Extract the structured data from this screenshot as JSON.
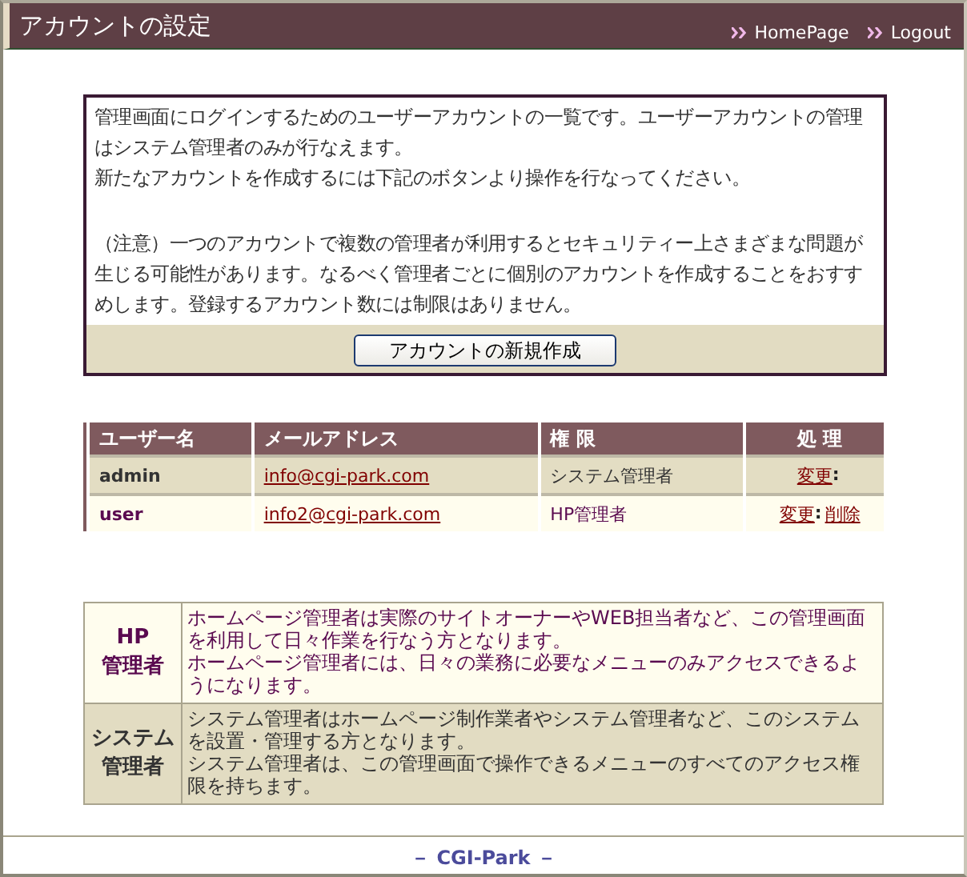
{
  "header": {
    "title": "アカウントの設定",
    "links": [
      {
        "label": "HomePage"
      },
      {
        "label": "Logout"
      }
    ]
  },
  "intro": {
    "paragraphs": [
      [
        "管理画面にログインするためのユーザーアカウントの一覧です。ユーザーアカウントの管理はシステム管理者のみが行なえます。",
        "新たなアカウントを作成するには下記のボタンより操作を行なってください。"
      ],
      [
        "（注意）一つのアカウントで複数の管理者が利用するとセキュリティー上さまざまな問題が生じる可能性があります。なるべく管理者ごとに個別のアカウントを作成することをおすすめします。登録するアカウント数には制限はありません。"
      ]
    ],
    "button": "アカウントの新規作成"
  },
  "accounts": {
    "columns": [
      "ユーザー名",
      "メールアドレス",
      "権 限",
      "処 理"
    ],
    "rows": [
      {
        "user": "admin",
        "email": "info@cgi-park.com",
        "role": "システム管理者",
        "actions": [
          {
            "kind": "link",
            "label": "変更"
          },
          {
            "kind": "text",
            "label": ":"
          }
        ]
      },
      {
        "user": "user",
        "email": "info2@cgi-park.com",
        "role": "HP管理者",
        "actions": [
          {
            "kind": "link",
            "label": "変更"
          },
          {
            "kind": "text",
            "label": ":"
          },
          {
            "kind": "link",
            "label": "削除"
          }
        ]
      }
    ]
  },
  "roles": [
    {
      "name": [
        "HP",
        "管理者"
      ],
      "paragraphs": [
        "ホームページ管理者は実際のサイトオーナーやWEB担当者など、この管理画面を利用して日々作業を行なう方となります。",
        "ホームページ管理者には、日々の業務に必要なメニューのみアクセスできるようになります。"
      ]
    },
    {
      "name": [
        "システム",
        "管理者"
      ],
      "paragraphs": [
        "システム管理者はホームページ制作業者やシステム管理者など、このシステムを設置・管理する方となります。",
        "システム管理者は、この管理画面で操作できるメニューのすべてのアクセス権限を持ちます。"
      ]
    }
  ],
  "footer": "－ CGI-Park －"
}
